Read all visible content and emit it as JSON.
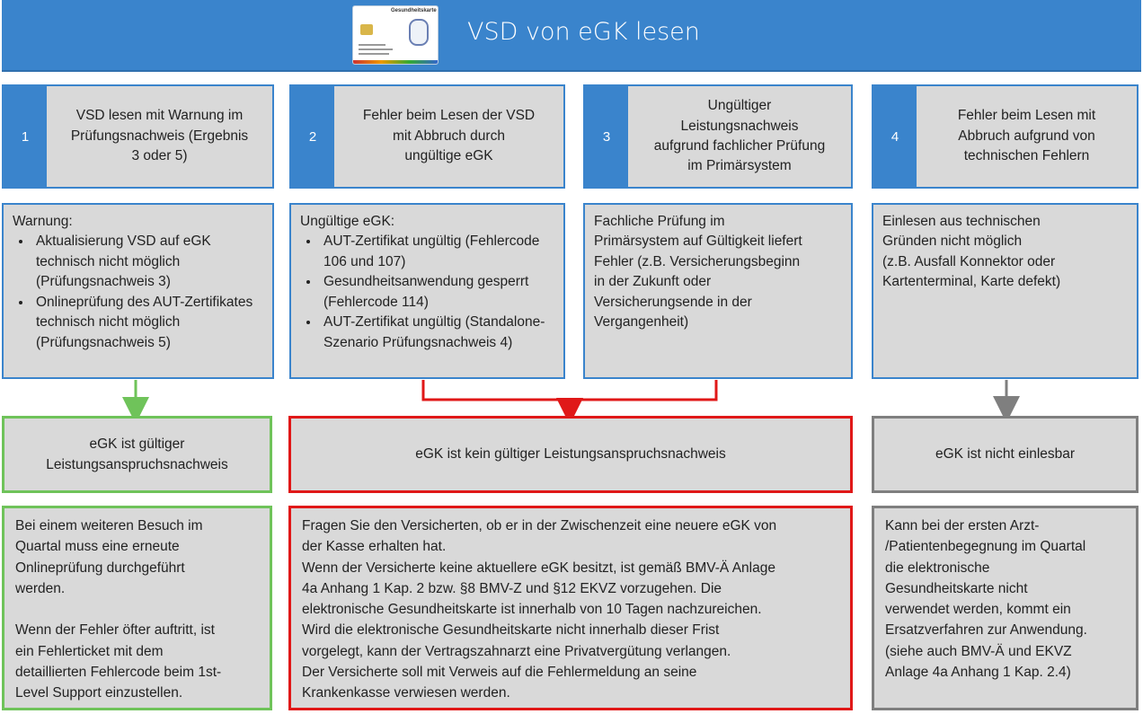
{
  "header": {
    "title": "VSD von eGK lesen",
    "card_icon": {
      "name": "health-card-icon",
      "label": "Gesundheitskarte"
    }
  },
  "columns": [
    {
      "number": "1",
      "title": "VSD lesen mit Warnung im\nPrüfungsnachweis (Ergebnis\n3 oder 5)",
      "detail_intro": "Warnung:",
      "detail_items": [
        "Aktualisierung  VSD auf eGK technisch  nicht  möglich (Prüfungsnachweis 3)",
        "Onlineprüfung  des AUT-Zertifikates technisch  nicht möglich  (Prüfungsnachweis 5)"
      ]
    },
    {
      "number": "2",
      "title": "Fehler beim Lesen der VSD\nmit Abbruch  durch\nungültige eGK",
      "detail_intro": "Ungültige eGK:",
      "detail_items": [
        "AUT-Zertifikat  ungültig (Fehlercode 106 und 107)",
        "Gesundheitsanwendung gesperrt (Fehlercode 114)",
        "AUT-Zertifikat  ungültig (Standalone-Szenario Prüfungsnachweis 4)"
      ]
    },
    {
      "number": "3",
      "title": "Ungültiger\nLeistungsnachweis\naufgrund fachlicher Prüfung\nim Primärsystem",
      "detail_text": "Fachliche  Prüfung im\nPrimärsystem  auf Gültigkeit liefert\nFehler (z.B. Versicherungsbeginn\nin der Zukunft oder\nVersicherungsende  in der\nVergangenheit)"
    },
    {
      "number": "4",
      "title": "Fehler beim Lesen mit\nAbbruch  aufgrund von\ntechnischen Fehlern",
      "detail_text": "Einlesen aus technischen\nGründen  nicht  möglich\n(z.B. Ausfall Konnektor oder\nKartenterminal, Karte defekt)"
    }
  ],
  "results": {
    "valid": {
      "label": "eGK ist gültiger\nLeistungsanspruchsnachweis",
      "advice": "Bei einem weiteren Besuch im\nQuartal muss eine erneute\nOnlineprüfung  durchgeführt\nwerden.\n\nWenn der Fehler öfter auftritt, ist\nein Fehlerticket mit dem\ndetaillierten  Fehlercode  beim 1st-\nLevel Support  einzustellen."
    },
    "invalid": {
      "label": "eGK ist kein gültiger Leistungsanspruchsnachweis",
      "advice": "Fragen Sie den Versicherten,  ob er in der Zwischenzeit eine neuere eGK von\nder Kasse erhalten hat.\nWenn der Versicherte keine aktuellere eGK besitzt, ist gemäß BMV-Ä Anlage\n4a Anhang 1 Kap. 2 bzw. §8 BMV-Z und §12 EKVZ vorzugehen. Die\nelektronische  Gesundheitskarte  ist innerhalb  von 10 Tagen nachzureichen.\nWird die elektronische  Gesundheitskarte  nicht  innerhalb  dieser Frist\nvorgelegt, kann der Vertragszahnarzt eine Privatvergütung  verlangen.\nDer Versicherte soll mit Verweis auf die Fehlermeldung  an seine\nKrankenkasse verwiesen werden."
    },
    "unreadable": {
      "label": "eGK ist nicht einlesbar",
      "advice": "Kann bei der ersten Arzt-\n/Patientenbegegnung im Quartal\ndie elektronische\nGesundheitskarte nicht\nverwendet werden, kommt ein\nErsatzverfahren zur Anwendung.\n(siehe auch BMV-Ä und EKVZ\nAnlage 4a Anhang 1 Kap. 2.4)"
    }
  },
  "colors": {
    "header_blue": "#3a84cc",
    "box_gray": "#d9d9d9",
    "valid_green": "#6fc35a",
    "invalid_red": "#e01818",
    "unreadable_gray": "#7f7f7f"
  }
}
